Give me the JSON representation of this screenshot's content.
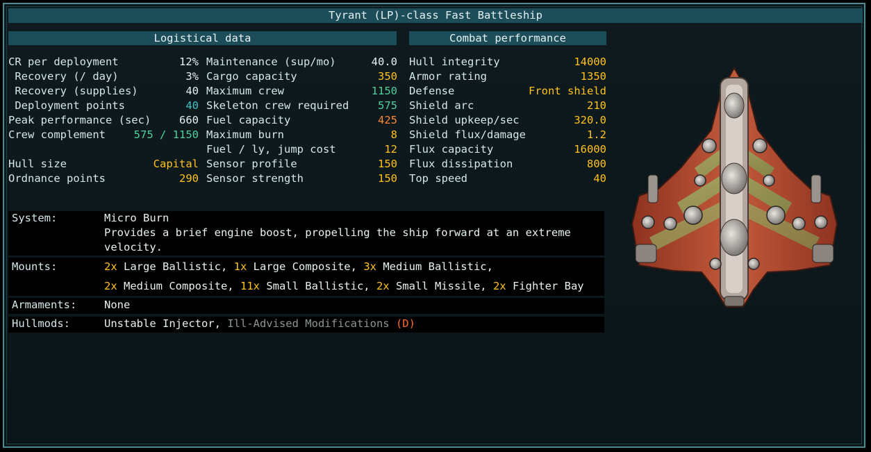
{
  "title": "Tyrant (LP)-class Fast Battleship",
  "logistical": {
    "header": "Logistical data",
    "left_rows": [
      {
        "label": "CR per deployment",
        "value": "12%"
      },
      {
        "label": " Recovery (/ day)",
        "value": "3%"
      },
      {
        "label": " Recovery (supplies)",
        "value": "40"
      },
      {
        "label": " Deployment points",
        "value": "40"
      },
      {
        "label": "Peak performance (sec)",
        "value": "660"
      },
      {
        "label": "Crew complement",
        "value": "575 / 1150"
      },
      {
        "label": "Hull size",
        "value": "Capital"
      },
      {
        "label": "Ordnance points",
        "value": "290"
      }
    ],
    "right_rows": [
      {
        "label": "Maintenance (sup/mo)",
        "value": "40.0"
      },
      {
        "label": "Cargo capacity",
        "value": "350"
      },
      {
        "label": "Maximum crew",
        "value": "1150"
      },
      {
        "label": "Skeleton crew required",
        "value": "575"
      },
      {
        "label": "Fuel capacity",
        "value": "425"
      },
      {
        "label": "Maximum burn",
        "value": "8"
      },
      {
        "label": "Fuel / ly, jump cost",
        "value": "12"
      },
      {
        "label": "Sensor profile",
        "value": "150"
      },
      {
        "label": "Sensor strength",
        "value": "150"
      }
    ]
  },
  "combat": {
    "header": "Combat performance",
    "rows": [
      {
        "label": "Hull integrity",
        "value": "14000"
      },
      {
        "label": "Armor rating",
        "value": "1350"
      },
      {
        "label": "Defense",
        "value": "Front shield"
      },
      {
        "label": "Shield arc",
        "value": "210"
      },
      {
        "label": "Shield upkeep/sec",
        "value": "320.0"
      },
      {
        "label": "Shield flux/damage",
        "value": "1.2"
      },
      {
        "label": "Flux capacity",
        "value": "16000"
      },
      {
        "label": "Flux dissipation",
        "value": "800"
      },
      {
        "label": "Top speed",
        "value": "40"
      }
    ]
  },
  "system": {
    "key": "System:",
    "name": "Micro Burn",
    "desc_line1": "Provides a brief engine boost, propelling the ship forward at an extreme",
    "desc_line2": "velocity."
  },
  "mounts": {
    "key": "Mounts:",
    "line1": [
      {
        "count": "2x",
        "text": " Large Ballistic, "
      },
      {
        "count": "1x",
        "text": " Large Composite, "
      },
      {
        "count": "3x",
        "text": " Medium Ballistic,"
      }
    ],
    "line2": [
      {
        "count": "2x",
        "text": " Medium Composite, "
      },
      {
        "count": "11x",
        "text": " Small Ballistic, "
      },
      {
        "count": "2x",
        "text": " Small Missile, "
      },
      {
        "count": "2x",
        "text": " Fighter Bay"
      }
    ]
  },
  "armaments": {
    "key": "Armaments:",
    "value": "None"
  },
  "hullmods": {
    "key": "Hullmods:",
    "mod1": "Unstable Injector, ",
    "mod2": "Ill-Advised Modifications ",
    "dmod_tag": "(D)"
  },
  "colors": {
    "panel_header": "#1e4d5a",
    "value_yellow": "#ffc31a",
    "value_cyan": "#3fc2c2",
    "value_green": "#4fd09c",
    "value_orange": "#ff8a3a",
    "dmod": "#ff6a2b",
    "frame": "#4d8a93"
  },
  "ship_image": {
    "icon": "ship-sprite"
  }
}
